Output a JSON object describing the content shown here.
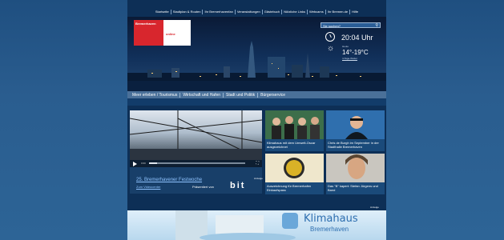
{
  "topnav": [
    "Startseite",
    "Stadtplan & Routen",
    "Ihr Bremerhavenfan",
    "Veranstaltungen",
    "Gästebuch",
    "Nützliche Links",
    "Webcams",
    "Ihr Bremen.de",
    "Hilfe"
  ],
  "logo": {
    "line1": "Bremerhaven",
    "line2": "online"
  },
  "search": {
    "placeholder": "Sie suchen?"
  },
  "clock": {
    "time": "20:04 Uhr"
  },
  "weather": {
    "label": "Heute",
    "temp": "14°-19°C",
    "link": "4-Tage-Wetter"
  },
  "catnav": [
    "Meer erleben / Tourismus",
    "Wirtschaft und Hafen",
    "Stadt und Politik",
    "Bürgerservice"
  ],
  "video": {
    "title": "25. Bremerhavener Festwoche",
    "link": "Anzeige",
    "more_link": "Zum Videocenter",
    "presented_by": "Präsentiert von",
    "brand": "bit",
    "current_time": "0:00",
    "progress": 0.08
  },
  "tiles": [
    {
      "caption": "Klimahaus mit dem Umwelt-Oscar ausgezeichnet"
    },
    {
      "caption": "Chris de Burgh im September in der Stadthalle Bremerhaven"
    },
    {
      "caption": "Auszeichnung für Bremerhafen Einkaufspass"
    },
    {
      "caption": "Das \"B\" kapert: Stefan Jürgens und Band"
    }
  ],
  "ad": {
    "label": "Anzeige",
    "title": "Klimahaus",
    "subtitle": "Bremerhaven"
  },
  "colors": {
    "accent": "#d8262d",
    "link": "#8fc3ff",
    "panel": "#0d2f56"
  }
}
